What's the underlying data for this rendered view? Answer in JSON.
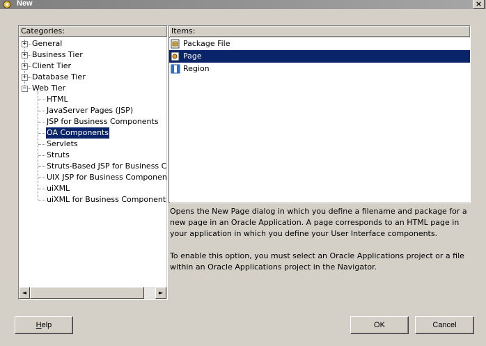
{
  "window": {
    "title": "New",
    "close_glyph": "×"
  },
  "categories": {
    "header": "Categories:",
    "nodes": [
      {
        "label": "General",
        "expander": "+"
      },
      {
        "label": "Business Tier",
        "expander": "+"
      },
      {
        "label": "Client Tier",
        "expander": "+"
      },
      {
        "label": "Database Tier",
        "expander": "+"
      },
      {
        "label": "Web Tier",
        "expander": "−"
      }
    ],
    "children": [
      {
        "label": "HTML"
      },
      {
        "label": "JavaServer Pages (JSP)"
      },
      {
        "label": "JSP for Business Components"
      },
      {
        "label": "OA Components",
        "selected": true
      },
      {
        "label": "Servlets"
      },
      {
        "label": "Struts"
      },
      {
        "label": "Struts-Based JSP for Business Com"
      },
      {
        "label": "UIX JSP for Business Components"
      },
      {
        "label": "uiXML"
      },
      {
        "label": "uiXML for Business Components"
      }
    ]
  },
  "scrollbar": {
    "left_glyph": "◄",
    "right_glyph": "►"
  },
  "items": {
    "header": "Items:",
    "list": [
      {
        "label": "Package File",
        "icon": "package-file-icon"
      },
      {
        "label": "Page",
        "icon": "page-icon",
        "selected": true
      },
      {
        "label": "Region",
        "icon": "region-icon"
      }
    ]
  },
  "description": {
    "para1": "Opens the New Page dialog in which you define a filename and package for a new page in an Oracle Application. A page corresponds to an HTML page in your application in which you define your User Interface components.",
    "para2": "To enable this option, you must select an Oracle Applications project or a file within an Oracle Applications project in the Navigator."
  },
  "buttons": {
    "help_mnemonic": "H",
    "help_rest": "elp",
    "ok": "OK",
    "cancel": "Cancel"
  },
  "colors": {
    "selection": "#0a246a",
    "dialog_bg": "#d4d0c8"
  }
}
